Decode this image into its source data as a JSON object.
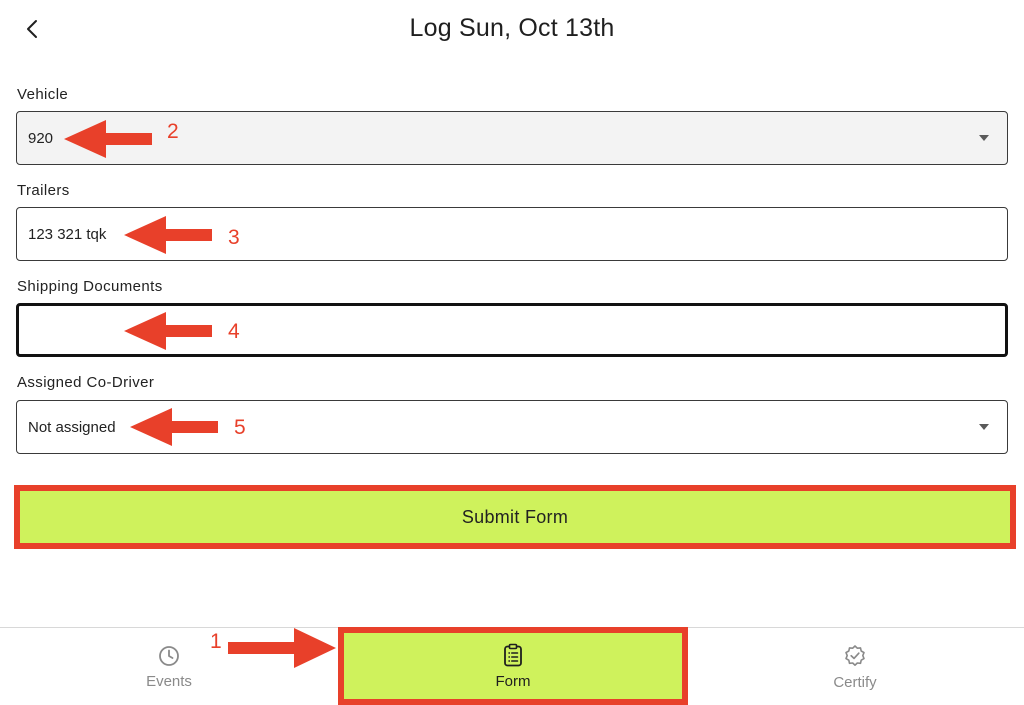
{
  "header": {
    "title": "Log Sun, Oct 13th",
    "back_icon": "chevron-left-icon"
  },
  "form": {
    "vehicle": {
      "label": "Vehicle",
      "value": "920"
    },
    "trailers": {
      "label": "Trailers",
      "value": "123 321 tqk"
    },
    "shipping_documents": {
      "label": "Shipping Documents",
      "value": ""
    },
    "co_driver": {
      "label": "Assigned Co-Driver",
      "value": "Not assigned"
    },
    "submit_label": "Submit Form"
  },
  "annotations": [
    "1",
    "2",
    "3",
    "4",
    "5"
  ],
  "nav": {
    "items": [
      {
        "label": "Events",
        "icon": "clock-icon"
      },
      {
        "label": "Form",
        "icon": "clipboard-list-icon",
        "active": true
      },
      {
        "label": "Certify",
        "icon": "badge-check-icon"
      }
    ]
  },
  "colors": {
    "accent": "#cff25c",
    "annotation": "#e8402a",
    "text": "#1f1f1f",
    "muted": "#8a8a8a"
  }
}
